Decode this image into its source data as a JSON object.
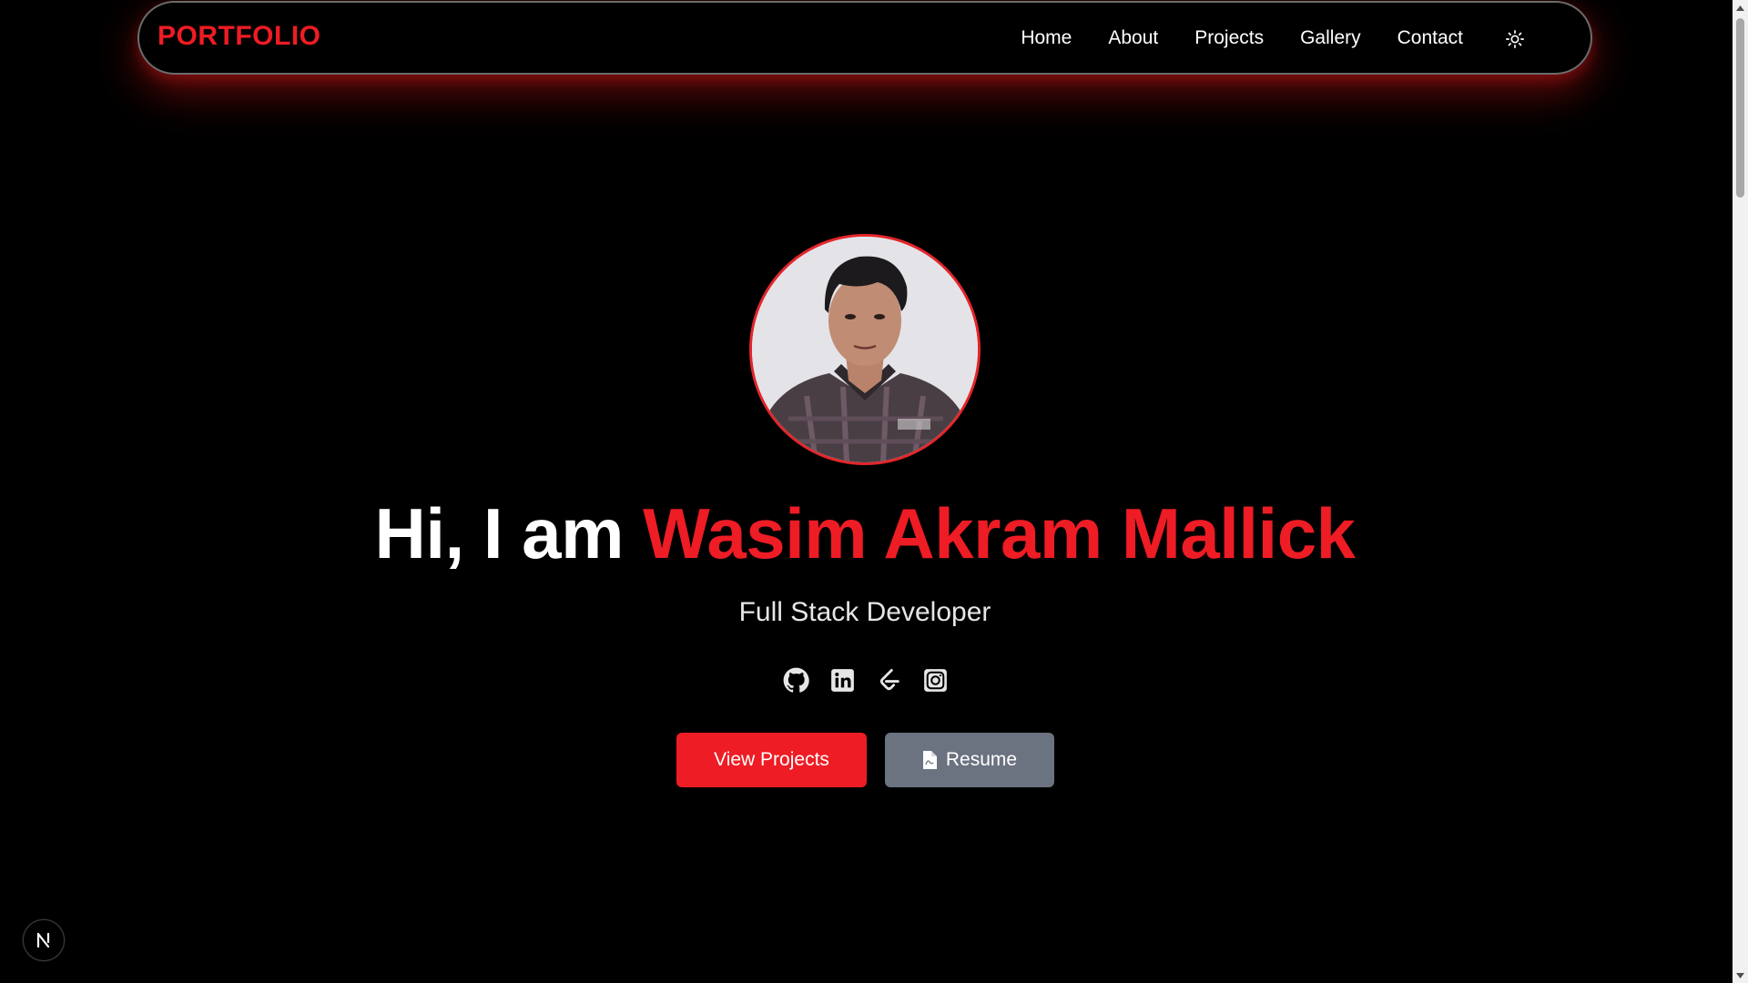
{
  "navbar": {
    "brand": "PORTFOLIO",
    "links": [
      "Home",
      "About",
      "Projects",
      "Gallery",
      "Contact"
    ],
    "theme_toggle_icon": "sun-icon"
  },
  "hero": {
    "greeting": "Hi, I am ",
    "name": "Wasim Akram Mallick",
    "role": "Full Stack Developer",
    "socials": [
      "github-icon",
      "linkedin-icon",
      "leetcode-icon",
      "instagram-icon"
    ],
    "primary_button": "View Projects",
    "secondary_button": "Resume",
    "secondary_button_icon": "pdf-file-icon"
  },
  "colors": {
    "accent": "#ee1c24",
    "secondary_button": "#6b7280",
    "background": "#000000"
  },
  "next_badge": "N"
}
